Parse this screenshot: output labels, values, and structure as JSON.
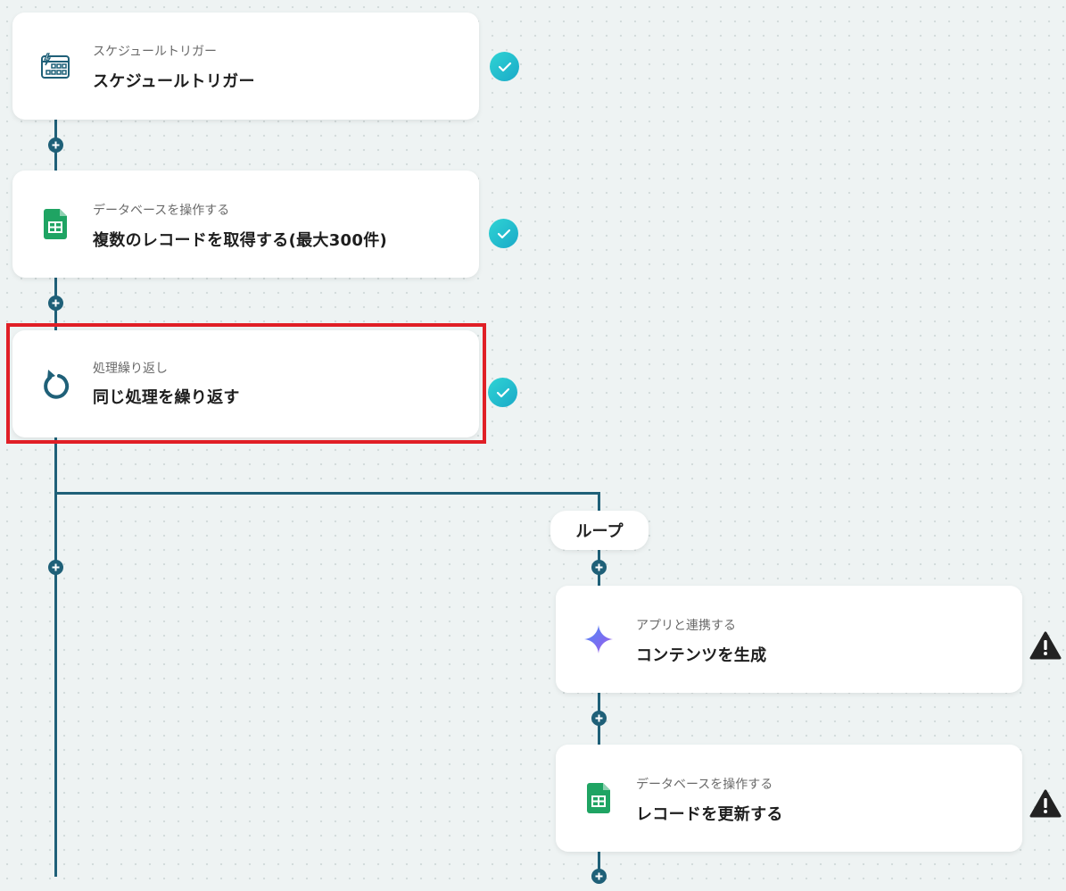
{
  "steps": [
    {
      "subtitle": "スケジュールトリガー",
      "title": "スケジュールトリガー",
      "icon": "calendar-clock-icon",
      "status": "complete"
    },
    {
      "subtitle": "データベースを操作する",
      "title": "複数のレコードを取得する(最大300件)",
      "icon": "spreadsheet-icon",
      "status": "complete"
    },
    {
      "subtitle": "処理繰り返し",
      "title": "同じ処理を繰り返す",
      "icon": "loop-arrow-icon",
      "status": "complete",
      "highlighted": true
    }
  ],
  "loop": {
    "label": "ループ",
    "steps": [
      {
        "subtitle": "アプリと連携する",
        "title": "コンテンツを生成",
        "icon": "sparkle-icon",
        "status": "warning"
      },
      {
        "subtitle": "データベースを操作する",
        "title": "レコードを更新する",
        "icon": "spreadsheet-icon",
        "status": "warning"
      }
    ]
  },
  "colors": {
    "connector": "#1f6078",
    "check": "#22c4d0",
    "highlight": "#e01f26",
    "warning": "#222222"
  }
}
